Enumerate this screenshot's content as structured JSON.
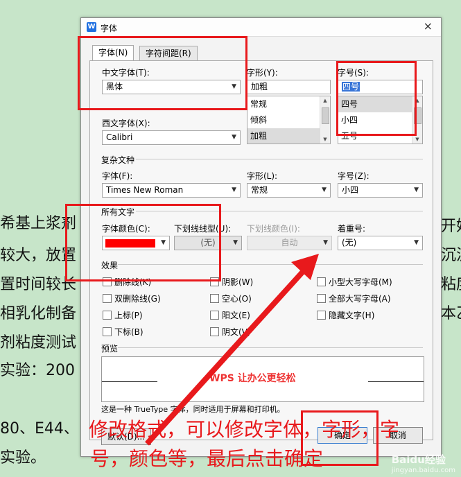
{
  "background_doc": {
    "lines": [
      "希基上浆剂",
      "较大，放置",
      "置时间较长",
      "相乳化制备",
      "剂粘度测试",
      "实验：200",
      "80、E44、",
      "实验。"
    ],
    "right_fragments": [
      "开始",
      "沉淀",
      "粘度",
      "本乙"
    ]
  },
  "dialog": {
    "title": "字体",
    "close": "×",
    "tabs": [
      "字体(N)",
      "字符间距(R)"
    ],
    "cn_font_label": "中文字体(T):",
    "cn_font_value": "黑体",
    "style_label": "字形(Y):",
    "style_value": "加粗",
    "style_options": [
      "常规",
      "倾斜",
      "加粗"
    ],
    "size_label": "字号(S):",
    "size_value": "四号",
    "size_options": [
      "四号",
      "小四",
      "五号"
    ],
    "west_font_label": "西文字体(X):",
    "west_font_value": "Calibri",
    "complex_group": "复杂文种",
    "complex_font_label": "字体(F):",
    "complex_font_value": "Times New Roman",
    "complex_style_label": "字形(L):",
    "complex_style_value": "常规",
    "complex_size_label": "字号(Z):",
    "complex_size_value": "小四",
    "all_text_group": "所有文字",
    "font_color_label": "字体颜色(C):",
    "font_color": "#ff0000",
    "underline_type_label": "下划线线型(U):",
    "underline_type_value": "(无)",
    "underline_color_label": "下划线颜色(I):",
    "underline_color_value": "自动",
    "emphasis_label": "着重号:",
    "emphasis_value": "(无)",
    "effects_group": "效果",
    "effects": {
      "col1": [
        "删除线(K)",
        "双删除线(G)",
        "上标(P)",
        "下标(B)"
      ],
      "col2": [
        "阴影(W)",
        "空心(O)",
        "阳文(E)",
        "阴文(V)"
      ],
      "col3": [
        "小型大写字母(M)",
        "全部大写字母(A)",
        "隐藏文字(H)"
      ]
    },
    "preview_group": "预览",
    "preview_text": "WPS 让办公更轻松",
    "note": "这是一种 TrueType 字体，同时适用于屏幕和打印机。",
    "default_button": "默认(D)...",
    "ok_button": "确定",
    "cancel_button": "取消"
  },
  "annotation": {
    "line1": "修改格式，可以修改字体，字形，字",
    "line2": "号，颜色等，最后点击确定",
    "color": "#e8191c"
  },
  "watermark": {
    "brand": "Baidu经验",
    "url": "jingyan.baidu.com"
  },
  "icons": [
    "wps-app-icon",
    "close-icon",
    "chevron-down-icon",
    "scroll-up-icon",
    "scroll-down-icon"
  ]
}
